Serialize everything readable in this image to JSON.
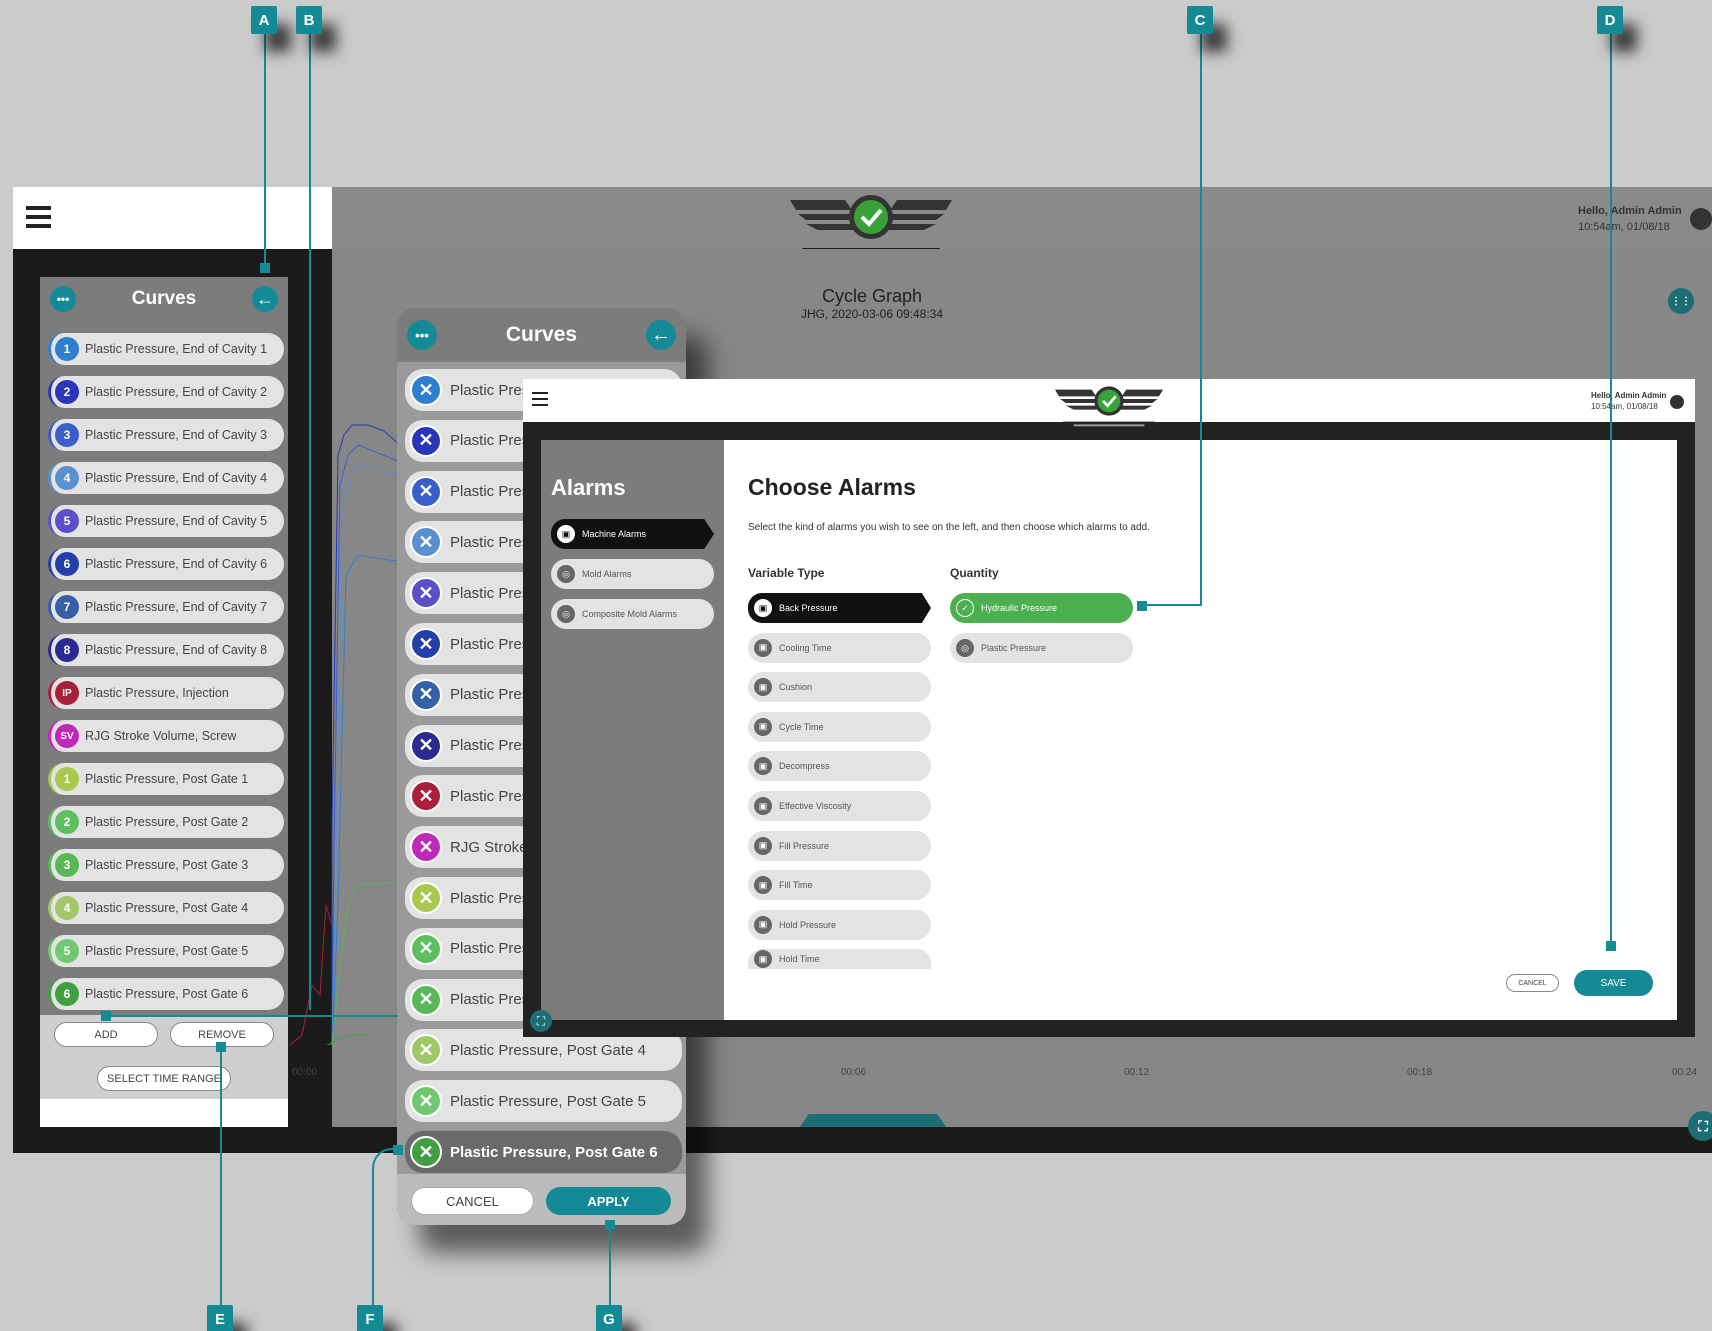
{
  "callouts": [
    "A",
    "B",
    "C",
    "D",
    "E",
    "F",
    "G"
  ],
  "main": {
    "header": {
      "greeting": "Hello, Admin Admin",
      "datetime": "10:54am, 01/08/18"
    },
    "graph": {
      "title": "Cycle Graph",
      "subtitle": "JHG, 2020-03-06   09:48:34",
      "ticks": [
        "00:00",
        "00:06",
        "00:12",
        "00:18",
        "00:24"
      ]
    }
  },
  "curves_panel": {
    "title": "Curves",
    "items": [
      {
        "badge": "1",
        "label": "Plastic Pressure, End of Cavity 1",
        "color": "#2f7fd0"
      },
      {
        "badge": "2",
        "label": "Plastic Pressure, End of Cavity 2",
        "color": "#2a35b8"
      },
      {
        "badge": "3",
        "label": "Plastic Pressure, End of Cavity 3",
        "color": "#3a5fc8"
      },
      {
        "badge": "4",
        "label": "Plastic Pressure, End of Cavity 4",
        "color": "#5a8fd0"
      },
      {
        "badge": "5",
        "label": "Plastic Pressure, End of Cavity 5",
        "color": "#5b50c8"
      },
      {
        "badge": "6",
        "label": "Plastic Pressure, End of Cavity 6",
        "color": "#2240a8"
      },
      {
        "badge": "7",
        "label": "Plastic Pressure, End of Cavity 7",
        "color": "#3560a8"
      },
      {
        "badge": "8",
        "label": "Plastic Pressure, End of Cavity 8",
        "color": "#2a2a90"
      },
      {
        "badge": "IP",
        "label": "Plastic Pressure, Injection",
        "color": "#a8203a"
      },
      {
        "badge": "SV",
        "label": "RJG Stroke Volume, Screw",
        "color": "#c028b8"
      },
      {
        "badge": "1",
        "label": "Plastic Pressure, Post Gate 1",
        "color": "#a8c850"
      },
      {
        "badge": "2",
        "label": "Plastic Pressure, Post Gate 2",
        "color": "#5cc060"
      },
      {
        "badge": "3",
        "label": "Plastic Pressure, Post Gate 3",
        "color": "#58b858"
      },
      {
        "badge": "4",
        "label": "Plastic Pressure, Post Gate 4",
        "color": "#a0c868"
      },
      {
        "badge": "5",
        "label": "Plastic Pressure, Post Gate 5",
        "color": "#70c870"
      },
      {
        "badge": "6",
        "label": "Plastic Pressure, Post Gate 6",
        "color": "#40a040"
      }
    ],
    "add_label": "ADD",
    "remove_label": "REMOVE",
    "time_range_label": "SELECT TIME RANGE"
  },
  "remove_panel": {
    "title": "Curves",
    "items": [
      {
        "label": "Plastic Pres",
        "color": "#2f7fd0"
      },
      {
        "label": "Plastic Pres",
        "color": "#2a35b8"
      },
      {
        "label": "Plastic Pres",
        "color": "#3a5fc8"
      },
      {
        "label": "Plastic Pres",
        "color": "#5a8fd0"
      },
      {
        "label": "Plastic Pres",
        "color": "#5b50c8"
      },
      {
        "label": "Plastic Pres",
        "color": "#2240a8"
      },
      {
        "label": "Plastic Pres",
        "color": "#3560a8"
      },
      {
        "label": "Plastic Pres",
        "color": "#2a2a90"
      },
      {
        "label": "Plastic Pres",
        "color": "#a8203a"
      },
      {
        "label": "RJG Stroke",
        "color": "#c028b8"
      },
      {
        "label": "Plastic Pres",
        "color": "#a8c850"
      },
      {
        "label": "Plastic Pres",
        "color": "#5cc060"
      },
      {
        "label": "Plastic Pres",
        "color": "#58b858"
      },
      {
        "label": "Plastic Pressure, Post Gate 4",
        "color": "#a0c868"
      },
      {
        "label": "Plastic Pressure, Post Gate 5",
        "color": "#70c870"
      },
      {
        "label": "Plastic Pressure, Post Gate 6",
        "color": "#40a040"
      }
    ],
    "cancel_label": "CANCEL",
    "apply_label": "APPLY"
  },
  "alarms": {
    "header": {
      "greeting": "Hello, Admin Admin",
      "datetime": "10:54am, 01/08/18"
    },
    "sidebar_title": "Alarms",
    "categories": [
      "Machine Alarms",
      "Mold Alarms",
      "Composite Mold Alarms"
    ],
    "title": "Choose Alarms",
    "instructions": "Select the kind of alarms you wish to see on the left, and then choose which alarms to add.",
    "variable_type_heading": "Variable Type",
    "quantity_heading": "Quantity",
    "variable_types": [
      "Back Pressure",
      "Cooling Time",
      "Cushion",
      "Cycle Time",
      "Decompress",
      "Effective Viscosity",
      "Fill Pressure",
      "Fill Time",
      "Hold Pressure",
      "Hold Time"
    ],
    "quantities": [
      "Hydraulic Pressure",
      "Plastic Pressure"
    ],
    "cancel_label": "CANCEL",
    "save_label": "SAVE"
  }
}
